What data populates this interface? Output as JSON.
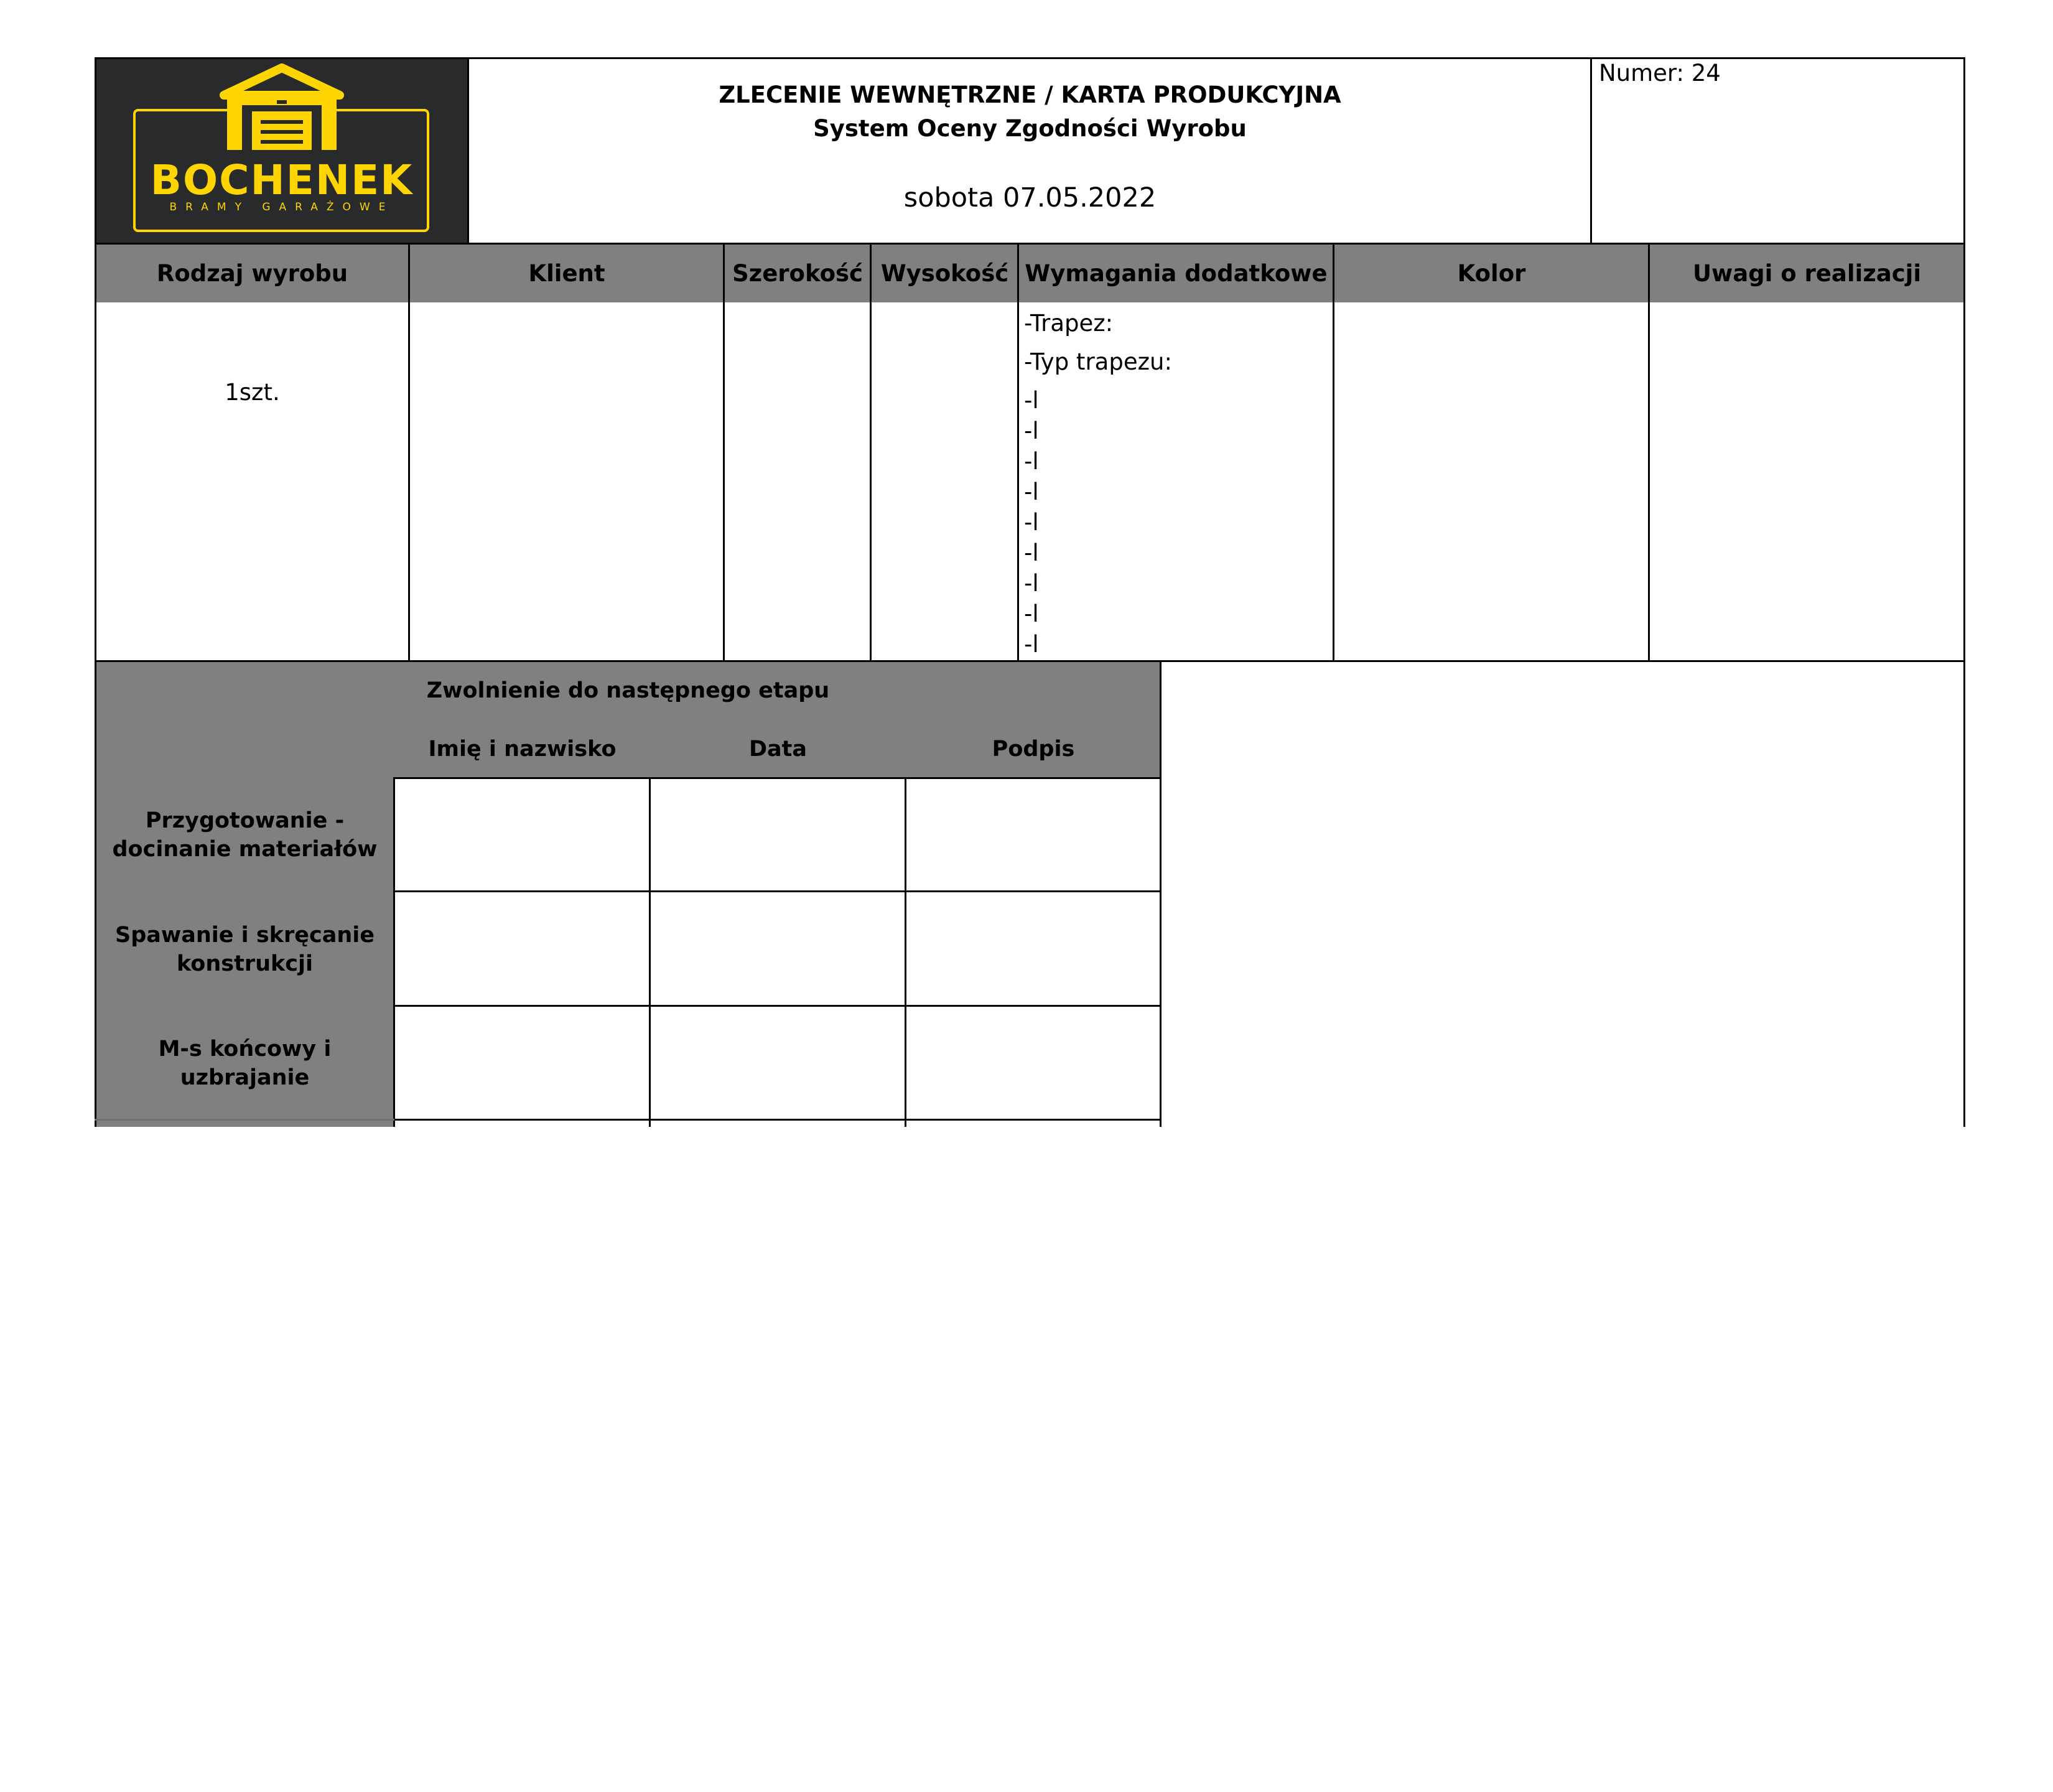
{
  "logo": {
    "brand": "BOCHENEK",
    "tagline": "BRAMY GARAŻOWE",
    "colors": {
      "background": "#282a2c",
      "accent": "#ffd500"
    }
  },
  "header": {
    "title": "ZLECENIE WEWNĘTRZNE / KARTA PRODUKCYJNA",
    "subtitle": "System Oceny Zgodności Wyrobu",
    "date": "sobota 07.05.2022",
    "number": "Numer: 24"
  },
  "product_table": {
    "columns": [
      "Rodzaj wyrobu",
      "Klient",
      "Szerokość",
      "Wysokość",
      "Wymagania dodatkowe",
      "Kolor",
      "Uwagi o realizacji"
    ],
    "row": {
      "rodzaj": "1szt.",
      "klient": "",
      "szerokosc": "",
      "wysokosc": "",
      "wymagania": [
        "-Trapez:",
        "-Typ trapezu:",
        "-l",
        "-l",
        "-l",
        "-l",
        "-l",
        "-l",
        "-l",
        "-l",
        "-l"
      ],
      "kolor": "",
      "uwagi": ""
    }
  },
  "release_table": {
    "title": "Zwolnienie do następnego etapu",
    "columns": [
      "Imię i nazwisko",
      "Data",
      "Podpis"
    ],
    "stages": [
      [
        "Przygotowanie -",
        "docinanie materiałów"
      ],
      [
        "Spawanie i skręcanie",
        "konstrukcji"
      ],
      [
        "M-s końcowy i",
        "uzbrajanie"
      ]
    ]
  },
  "colors": {
    "header_grey": "#808080",
    "border": "#000000"
  }
}
